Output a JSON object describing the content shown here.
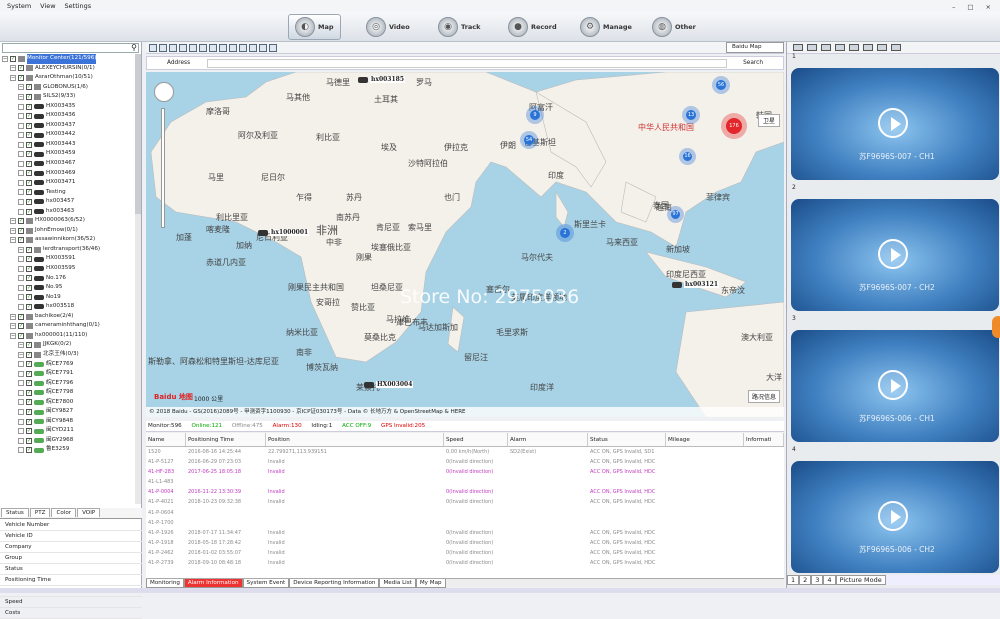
{
  "menu": [
    "System",
    "View",
    "Settings"
  ],
  "toolbar": [
    {
      "label": "Map",
      "icon": "map-icon"
    },
    {
      "label": "Video",
      "icon": "video-icon"
    },
    {
      "label": "Track",
      "icon": "track-icon"
    },
    {
      "label": "Record",
      "icon": "record-icon"
    },
    {
      "label": "Manage",
      "icon": "manage-icon"
    },
    {
      "label": "Other",
      "icon": "other-icon"
    }
  ],
  "tree": [
    {
      "t": "Monitor Center(121/596)",
      "lvl": 0,
      "kind": "root",
      "sel": true
    },
    {
      "t": "ALEXEYCHURSIN(0/1)",
      "lvl": 1,
      "kind": "grp"
    },
    {
      "t": "AsrarOthman(10/51)",
      "lvl": 1,
      "kind": "grp"
    },
    {
      "t": "GLOBONUS(1/6)",
      "lvl": 2,
      "kind": "grp"
    },
    {
      "t": "SILS2(9/33)",
      "lvl": 2,
      "kind": "grp"
    },
    {
      "t": "HX003435",
      "lvl": 2,
      "kind": "car"
    },
    {
      "t": "HX003436",
      "lvl": 2,
      "kind": "car"
    },
    {
      "t": "HX003437",
      "lvl": 2,
      "kind": "car"
    },
    {
      "t": "HX003442",
      "lvl": 2,
      "kind": "car"
    },
    {
      "t": "HX003443",
      "lvl": 2,
      "kind": "car"
    },
    {
      "t": "HX003459",
      "lvl": 2,
      "kind": "car"
    },
    {
      "t": "HX003467",
      "lvl": 2,
      "kind": "car"
    },
    {
      "t": "HX003469",
      "lvl": 2,
      "kind": "car"
    },
    {
      "t": "HX003471",
      "lvl": 2,
      "kind": "car"
    },
    {
      "t": "Testing",
      "lvl": 2,
      "kind": "car"
    },
    {
      "t": "hx003457",
      "lvl": 2,
      "kind": "car"
    },
    {
      "t": "hx003463",
      "lvl": 2,
      "kind": "car"
    },
    {
      "t": "HX0000063(6/52)",
      "lvl": 1,
      "kind": "grp"
    },
    {
      "t": "JohnErnow(0/1)",
      "lvl": 1,
      "kind": "grp"
    },
    {
      "t": "assawinnikorn(36/52)",
      "lvl": 1,
      "kind": "grp"
    },
    {
      "t": "lerdtransport(36/46)",
      "lvl": 2,
      "kind": "grp"
    },
    {
      "t": "HX003591",
      "lvl": 2,
      "kind": "car"
    },
    {
      "t": "HX003595",
      "lvl": 2,
      "kind": "car"
    },
    {
      "t": "No.176",
      "lvl": 2,
      "kind": "car"
    },
    {
      "t": "No.95",
      "lvl": 2,
      "kind": "car"
    },
    {
      "t": "No19",
      "lvl": 2,
      "kind": "car"
    },
    {
      "t": "hx003518",
      "lvl": 2,
      "kind": "car"
    },
    {
      "t": "bachikoe(2/4)",
      "lvl": 1,
      "kind": "grp"
    },
    {
      "t": "cameraminhthang(0/1)",
      "lvl": 1,
      "kind": "grp"
    },
    {
      "t": "hx000001(11/110)",
      "lvl": 1,
      "kind": "grp"
    },
    {
      "t": "JJKGK(0/2)",
      "lvl": 2,
      "kind": "grp"
    },
    {
      "t": "北京王伟(0/3)",
      "lvl": 2,
      "kind": "grp"
    },
    {
      "t": "皖CE7769",
      "lvl": 2,
      "kind": "carg"
    },
    {
      "t": "皖CE7791",
      "lvl": 2,
      "kind": "carg"
    },
    {
      "t": "皖CE7796",
      "lvl": 2,
      "kind": "carg"
    },
    {
      "t": "皖CE7798",
      "lvl": 2,
      "kind": "carg"
    },
    {
      "t": "皖CE7800",
      "lvl": 2,
      "kind": "carg"
    },
    {
      "t": "闽CY9827",
      "lvl": 2,
      "kind": "carg"
    },
    {
      "t": "闽CY9848",
      "lvl": 2,
      "kind": "carg"
    },
    {
      "t": "闽CYD211",
      "lvl": 2,
      "kind": "carg"
    },
    {
      "t": "闽GY2968",
      "lvl": 2,
      "kind": "carg"
    },
    {
      "t": "鲁E3259",
      "lvl": 2,
      "kind": "carg"
    }
  ],
  "left_tabs": [
    "Status",
    "PTZ",
    "Color",
    "VOIP"
  ],
  "props": [
    "Vehicle Number",
    "Vehicle ID",
    "Company",
    "Group",
    "Status",
    "Positioning Time",
    "Location",
    "Speed",
    "Costs"
  ],
  "map": {
    "type_select": "Baidu Map",
    "address_label": "Address",
    "search_label": "Search",
    "satellite": "卫星",
    "road": "路况信息",
    "scale": "1000 公里",
    "baidu": "Baidu 地图",
    "watermark": "Store No: 2975036",
    "copyright": "© 2018 Baidu - GS(2016)2089号 - 甲测资字1100930 - 京ICP证030173号 - Data © 长地万方 & OpenStreetMap & HERE",
    "clusters": [
      {
        "n": "56"
      },
      {
        "n": "9"
      },
      {
        "n": "54"
      },
      {
        "n": "13"
      },
      {
        "n": "176"
      },
      {
        "n": "16"
      },
      {
        "n": "2"
      },
      {
        "n": "97"
      }
    ],
    "vehicles": [
      "hx003185",
      "hx1000001",
      "hx003121",
      "HX003004"
    ],
    "labels": [
      "土耳其",
      "马其他",
      "摩洛哥",
      "阿尔及利亚",
      "利比亚",
      "埃及",
      "伊拉克",
      "伊朗",
      "阿富汗",
      "巴基斯坦",
      "印度",
      "中华人民共和国",
      "韩国",
      "泰国",
      "马里",
      "尼日尔",
      "尼日利亚",
      "乍得",
      "苏丹",
      "沙特阿拉伯",
      "也门",
      "埃塞俄比亚",
      "非洲",
      "刚果",
      "坦桑尼亚",
      "安哥拉",
      "赞比亚",
      "纳米比亚",
      "南非",
      "马达加斯加",
      "莫桑比克",
      "马尔代夫",
      "斯里兰卡",
      "印度尼西亚",
      "东帝汶",
      "澳大利亚",
      "印度洋",
      "大洋",
      "加蓬",
      "喀麦隆",
      "肯尼亚",
      "索马里",
      "英属印度洋领地",
      "赤道几内亚",
      "刚果民主共和国",
      "马拉维",
      "博茨瓦纳",
      "南苏丹",
      "塞舌尔",
      "留尼汪",
      "毛里求斯",
      "新加坡",
      "马来西亚",
      "菲律宾",
      "越南",
      "马德里",
      "罗马",
      "利比里亚",
      "加纳",
      "中非",
      "莱索托",
      "津巴布韦"
    ],
    "bottom_label": "斯勒拿、阿森松和特里斯坦-达库尼亚"
  },
  "stat": {
    "monitor": "Monitor:596",
    "online": "Online:121",
    "offline": "Offline:475",
    "alarm": "Alarm:130",
    "idling": "Idling:1",
    "acc": "ACC OFF:9",
    "gps": "GPS Invalid:205"
  },
  "grid": {
    "headers": [
      "Name",
      "Positioning Time",
      "Position",
      "Speed",
      "Alarm",
      "Status",
      "Mileage",
      "Informati"
    ],
    "rows": [
      {
        "c": [
          "1520",
          "2016-08-16 14:25:44",
          "22.799271,113.939151",
          "0.00 km/h(North)",
          "SD2(Exist)",
          "ACC ON, GPS Invalid, SD1",
          "",
          ""
        ],
        "m": false
      },
      {
        "c": [
          "41-P-5127",
          "2016-06-29 07:23:03",
          "Invalid",
          "0(Invalid direction)",
          "",
          "ACC ON, GPS Invalid, HDC",
          "",
          ""
        ],
        "m": false
      },
      {
        "c": [
          "41-HF-283",
          "2017-06-25 18:05:18",
          "Invalid",
          "0(Invalid direction)",
          "",
          "ACC ON, GPS Invalid, HDC",
          "",
          ""
        ],
        "m": true
      },
      {
        "c": [
          "41-L1-483",
          "",
          "",
          "",
          "",
          "",
          "",
          ""
        ],
        "m": false
      },
      {
        "c": [
          "41-P-0004",
          "2016-11-22 13:30:39",
          "Invalid",
          "0(Invalid direction)",
          "",
          "ACC ON, GPS Invalid, HDC",
          "",
          ""
        ],
        "m": true
      },
      {
        "c": [
          "41-P-4021",
          "2018-10-23 09:32:38",
          "Invalid",
          "0(Invalid direction)",
          "",
          "ACC ON, GPS Invalid, HDC",
          "",
          ""
        ],
        "m": false
      },
      {
        "c": [
          "41-P-0604",
          "",
          "",
          "",
          "",
          "",
          "",
          ""
        ],
        "m": false
      },
      {
        "c": [
          "41-P-1700",
          "",
          "",
          "",
          "",
          "",
          "",
          ""
        ],
        "m": false
      },
      {
        "c": [
          "41-P-1926",
          "2018-07-17 11:34:47",
          "Invalid",
          "0(Invalid direction)",
          "",
          "ACC ON, GPS Invalid, HDC",
          "",
          ""
        ],
        "m": false
      },
      {
        "c": [
          "41-P-1918",
          "2018-05-18 17:28:42",
          "Invalid",
          "0(Invalid direction)",
          "",
          "ACC ON, GPS Invalid, HDC",
          "",
          ""
        ],
        "m": false
      },
      {
        "c": [
          "41-P-2462",
          "2018-01-02 03:55:07",
          "Invalid",
          "0(Invalid direction)",
          "",
          "ACC ON, GPS Invalid, HDC",
          "",
          ""
        ],
        "m": false
      },
      {
        "c": [
          "41-P-2739",
          "2018-09-10 08:48:18",
          "Invalid",
          "0(Invalid direction)",
          "",
          "ACC ON, GPS Invalid, HDC",
          "",
          ""
        ],
        "m": false
      }
    ]
  },
  "bottom_tabs": [
    "Monitoring",
    "Alarm Information",
    "System Event",
    "Device Reporting Information",
    "Media List",
    "My Map"
  ],
  "video": {
    "channels": [
      {
        "n": "1",
        "cap": "苏F9696S-007 - CH1"
      },
      {
        "n": "2",
        "cap": "苏F9696S-007 - CH2"
      },
      {
        "n": "3",
        "cap": "苏F9696S-006 - CH1"
      },
      {
        "n": "4",
        "cap": "苏F9696S-006 - CH2"
      }
    ],
    "page_tabs": [
      "1",
      "2",
      "3",
      "4",
      "Picture Mode"
    ]
  }
}
